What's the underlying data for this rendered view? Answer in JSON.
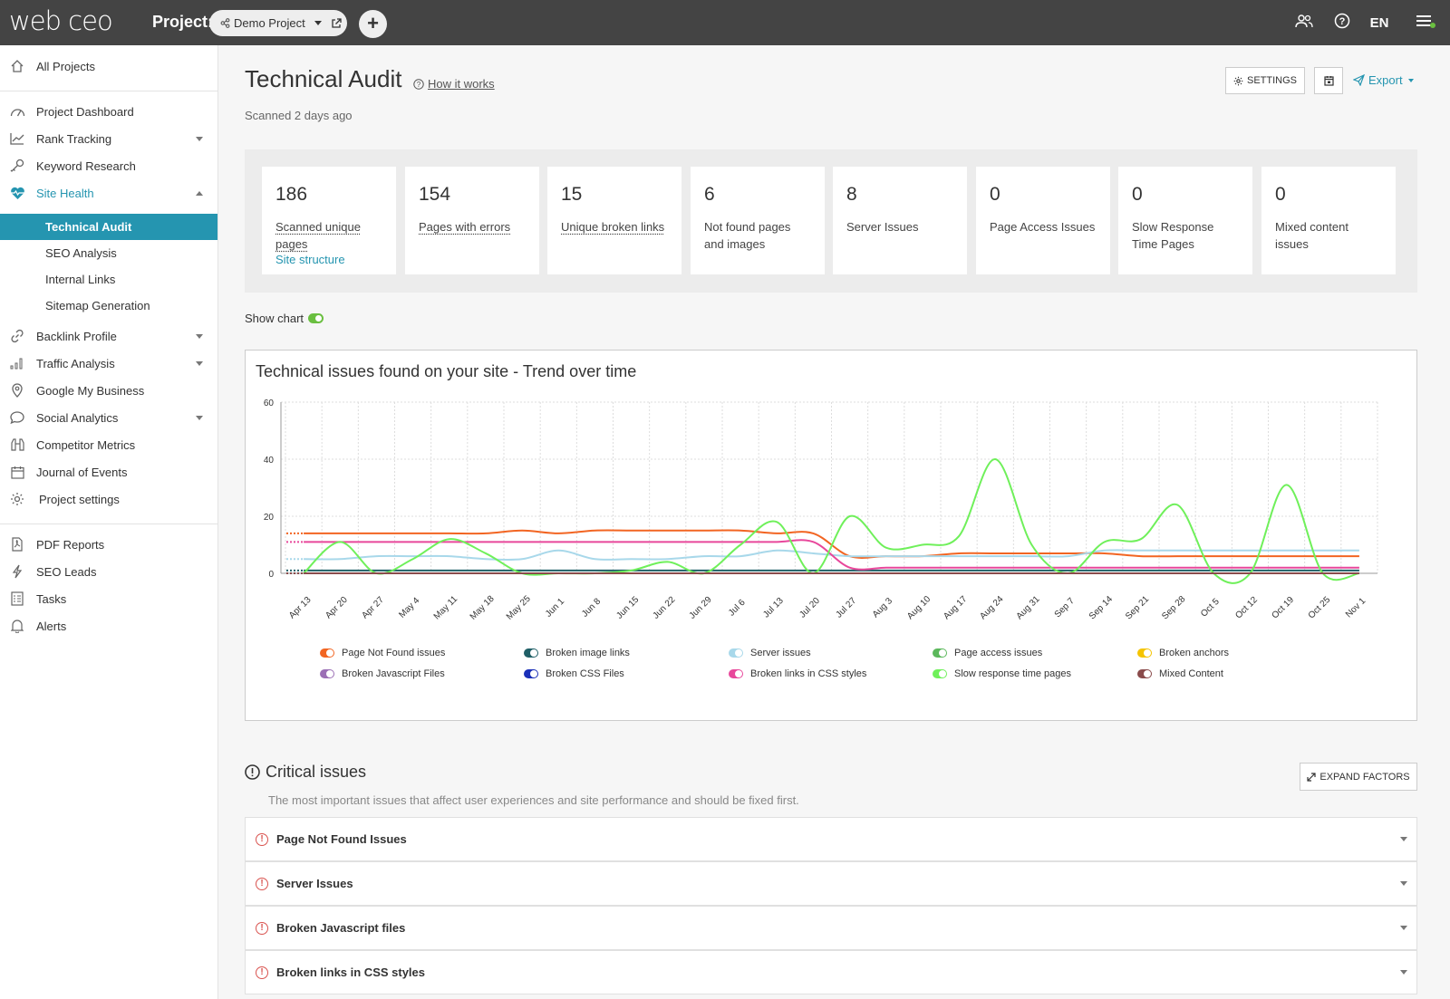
{
  "app": {
    "logo": "web ceo",
    "project_label": "Project:",
    "project_name": "Demo Project",
    "lang": "EN"
  },
  "sidebar": {
    "all_projects": "All Projects",
    "items": [
      {
        "label": "Project Dashboard",
        "icon": "dashboard-icon"
      },
      {
        "label": "Rank Tracking",
        "icon": "chart-line-icon"
      },
      {
        "label": "Keyword Research",
        "icon": "key-icon"
      },
      {
        "label": "Site Health",
        "icon": "heartbeat-icon"
      },
      {
        "label": "Technical Audit"
      },
      {
        "label": "SEO Analysis"
      },
      {
        "label": "Internal Links"
      },
      {
        "label": "Sitemap Generation"
      },
      {
        "label": "Backlink Profile",
        "icon": "link-icon"
      },
      {
        "label": "Traffic Analysis",
        "icon": "bar-chart-icon"
      },
      {
        "label": "Google My Business",
        "icon": "map-pin-icon"
      },
      {
        "label": "Social Analytics",
        "icon": "chat-icon"
      },
      {
        "label": "Competitor Metrics",
        "icon": "binoculars-icon"
      },
      {
        "label": "Journal of Events",
        "icon": "calendar-icon"
      },
      {
        "label": "Project settings",
        "icon": "gear-icon"
      }
    ],
    "bottom": [
      {
        "label": "PDF Reports",
        "icon": "pdf-icon"
      },
      {
        "label": "SEO Leads",
        "icon": "lightning-icon"
      },
      {
        "label": "Tasks",
        "icon": "tasks-icon"
      },
      {
        "label": "Alerts",
        "icon": "bell-icon"
      }
    ]
  },
  "header": {
    "title": "Technical Audit",
    "how_it_works": "How it works",
    "scanned": "Scanned 2 days ago",
    "settings": "SETTINGS",
    "export": "Export"
  },
  "stats": [
    {
      "value": "186",
      "label": "Scanned unique pages",
      "link": "Site structure"
    },
    {
      "value": "154",
      "label": "Pages with errors"
    },
    {
      "value": "15",
      "label": "Unique broken links"
    },
    {
      "value": "6",
      "label": "Not found pages and images"
    },
    {
      "value": "8",
      "label": "Server Issues"
    },
    {
      "value": "0",
      "label": "Page Access Issues"
    },
    {
      "value": "0",
      "label": "Slow Response Time Pages"
    },
    {
      "value": "0",
      "label": "Mixed content issues"
    }
  ],
  "show_chart": "Show chart",
  "chart_data": {
    "type": "line",
    "title": "Technical issues found on your site - Trend over time",
    "ylim": [
      0,
      60
    ],
    "yticks": [
      0,
      20,
      40,
      60
    ],
    "categories": [
      "Apr 13",
      "Apr 20",
      "Apr 27",
      "May 4",
      "May 11",
      "May 18",
      "May 25",
      "Jun 1",
      "Jun 8",
      "Jun 15",
      "Jun 22",
      "Jun 29",
      "Jul 6",
      "Jul 13",
      "Jul 20",
      "Jul 27",
      "Aug 3",
      "Aug 10",
      "Aug 17",
      "Aug 24",
      "Aug 31",
      "Sep 7",
      "Sep 14",
      "Sep 21",
      "Sep 28",
      "Oct 5",
      "Oct 12",
      "Oct 19",
      "Oct 25",
      "Nov 1"
    ],
    "series": [
      {
        "name": "Page Not Found issues",
        "color": "#f26522",
        "values": [
          14,
          14,
          14,
          14,
          14,
          14,
          15,
          14,
          15,
          15,
          15,
          15,
          15,
          14,
          14,
          6,
          6,
          6,
          7,
          7,
          7,
          7,
          7,
          6,
          6,
          6,
          6,
          6,
          6,
          6
        ]
      },
      {
        "name": "Broken image links",
        "color": "#1f5f66",
        "values": [
          1,
          1,
          1,
          1,
          1,
          1,
          1,
          1,
          1,
          1,
          1,
          1,
          1,
          1,
          1,
          1,
          1,
          1,
          1,
          1,
          1,
          1,
          1,
          1,
          1,
          1,
          1,
          1,
          1,
          1
        ]
      },
      {
        "name": "Server issues",
        "color": "#a8d8ea",
        "values": [
          5,
          5,
          6,
          6,
          6,
          5,
          5,
          8,
          5,
          5,
          5,
          6,
          6,
          8,
          7,
          6,
          6,
          6,
          6,
          6,
          6,
          6,
          8,
          8,
          8,
          8,
          8,
          8,
          8,
          8
        ]
      },
      {
        "name": "Page access issues",
        "color": "#5cb85c",
        "values": [
          0,
          0,
          0,
          0,
          0,
          0,
          0,
          0,
          0,
          0,
          0,
          0,
          0,
          0,
          0,
          0,
          0,
          0,
          0,
          0,
          0,
          0,
          0,
          0,
          0,
          0,
          0,
          0,
          0,
          0
        ]
      },
      {
        "name": "Broken anchors",
        "color": "#f5c400",
        "values": [
          0,
          0,
          0,
          0,
          0,
          0,
          0,
          0,
          0,
          0,
          0,
          0,
          0,
          0,
          0,
          0,
          0,
          0,
          0,
          0,
          0,
          0,
          0,
          0,
          0,
          0,
          0,
          0,
          0,
          0
        ]
      },
      {
        "name": "Broken Javascript Files",
        "color": "#9b6fb5",
        "values": [
          0,
          0,
          0,
          0,
          0,
          0,
          0,
          0,
          0,
          0,
          0,
          0,
          0,
          0,
          0,
          0,
          0,
          0,
          0,
          0,
          0,
          0,
          0,
          0,
          0,
          0,
          0,
          0,
          0,
          0
        ]
      },
      {
        "name": "Broken CSS Files",
        "color": "#1a2fb8",
        "values": [
          0,
          0,
          0,
          0,
          0,
          0,
          0,
          0,
          0,
          0,
          0,
          0,
          0,
          0,
          0,
          0,
          0,
          0,
          0,
          0,
          0,
          0,
          0,
          0,
          0,
          0,
          0,
          0,
          0,
          0
        ]
      },
      {
        "name": "Broken links in CSS styles",
        "color": "#e8479b",
        "values": [
          11,
          11,
          11,
          11,
          11,
          11,
          11,
          11,
          11,
          11,
          11,
          11,
          11,
          11,
          11,
          2,
          2,
          2,
          2,
          2,
          2,
          2,
          2,
          2,
          2,
          2,
          2,
          2,
          2,
          2
        ]
      },
      {
        "name": "Slow response time pages",
        "color": "#6ff05a",
        "values": [
          0,
          11,
          0,
          5,
          12,
          7,
          0,
          0,
          0,
          1,
          4,
          0,
          10,
          18,
          0,
          20,
          9,
          10,
          13,
          40,
          10,
          0,
          11,
          12,
          24,
          0,
          0,
          31,
          0,
          0
        ]
      },
      {
        "name": "Mixed Content",
        "color": "#8a4b4b",
        "values": [
          0,
          0,
          0,
          0,
          0,
          0,
          0,
          0,
          0,
          0,
          0,
          0,
          0,
          0,
          0,
          0,
          0,
          0,
          0,
          0,
          0,
          0,
          0,
          0,
          0,
          0,
          0,
          0,
          0,
          0
        ]
      }
    ]
  },
  "critical": {
    "title": "Critical issues",
    "desc": "The most important issues that affect user experiences and site performance and should be fixed first.",
    "expand": "EXPAND FACTORS",
    "issues": [
      "Page Not Found Issues",
      "Server Issues",
      "Broken Javascript files",
      "Broken links in CSS styles"
    ]
  }
}
